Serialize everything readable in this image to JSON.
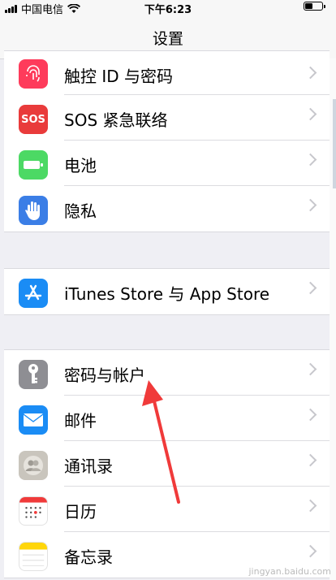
{
  "status_bar": {
    "carrier": "中国电信",
    "time": "下午6:23"
  },
  "nav": {
    "title": "设置"
  },
  "groups": [
    {
      "items": [
        {
          "label": "触控 ID 与密码",
          "icon": "fingerprint-icon",
          "color": "#fe3b5b"
        },
        {
          "label": "SOS 紧急联络",
          "icon": "sos-icon",
          "color": "#e93b3b",
          "icon_text": "SOS"
        },
        {
          "label": "电池",
          "icon": "battery-icon",
          "color": "#4cd964"
        },
        {
          "label": "隐私",
          "icon": "hand-icon",
          "color": "#3b7ee6"
        }
      ]
    },
    {
      "items": [
        {
          "label": "iTunes Store 与 App Store",
          "icon": "app-store-icon",
          "color": "#1a8cf5"
        }
      ]
    },
    {
      "items": [
        {
          "label": "密码与帐户",
          "icon": "key-icon",
          "color": "#8e8e93"
        },
        {
          "label": "邮件",
          "icon": "mail-icon",
          "color": "#1a8cf5"
        },
        {
          "label": "通讯录",
          "icon": "contacts-icon",
          "color": "#c9c5bd"
        },
        {
          "label": "日历",
          "icon": "calendar-icon",
          "color": "#ffffff"
        },
        {
          "label": "备忘录",
          "icon": "notes-icon",
          "color": "#ffd60a"
        }
      ]
    }
  ],
  "annotation": {
    "color": "#f03a3a"
  }
}
